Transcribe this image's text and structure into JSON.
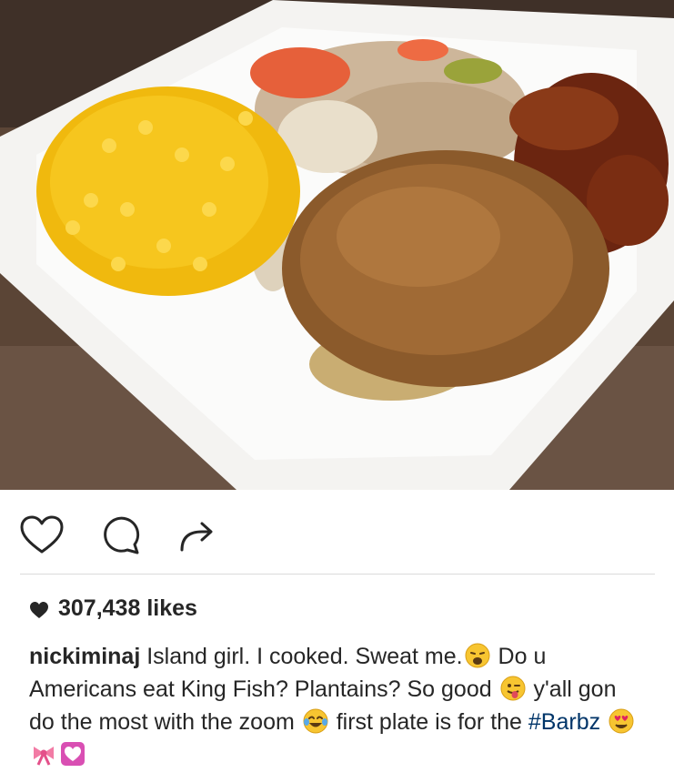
{
  "post": {
    "image_alt": "Plate with corn, rice, cabbage, tomato, fried fish and plantains",
    "likes_text": "307,438 likes",
    "caption": {
      "username": "nickiminaj",
      "segment1": " Island girl. I cooked. Sweat me.",
      "segment2": " Do u Americans eat King Fish? Plantains? So good ",
      "segment3": " y'all gon do the most with the zoom ",
      "segment4": " first plate is for the ",
      "hashtag": "#Barbz",
      "segment5": " "
    }
  },
  "icons": {
    "like": "heart-outline-icon",
    "comment": "comment-bubble-icon",
    "share": "share-arrow-icon",
    "likes_heart": "heart-filled-icon",
    "emojis": [
      "weary-face-emoji",
      "winking-tongue-emoji",
      "tears-of-joy-emoji",
      "heart-eyes-emoji",
      "ribbon-emoji",
      "heart-box-emoji"
    ]
  },
  "colors": {
    "text": "#262626",
    "hashtag": "#003569",
    "divider": "#dbdbdb"
  }
}
